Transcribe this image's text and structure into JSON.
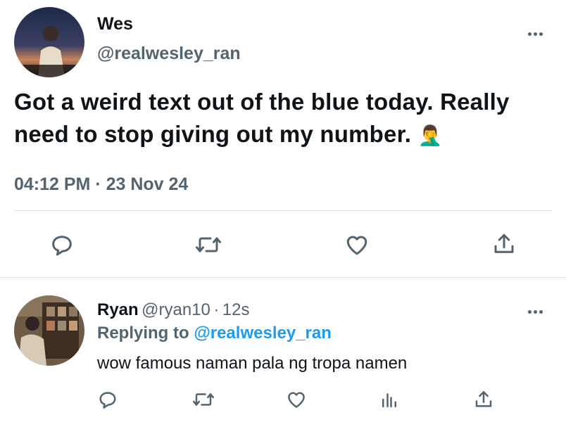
{
  "tweet": {
    "author_name": "Wes",
    "author_handle": "@realwesley_ran",
    "text": "Got a weird text out of the blue today. Really need to stop giving out my number.",
    "emoji": "🤦‍♂️",
    "timestamp": "04:12 PM · 23 Nov 24"
  },
  "reply": {
    "author_name": "Ryan",
    "author_handle": "@ryan10",
    "time_sep": "·",
    "time": "12s",
    "replying_prefix": "Replying to",
    "replying_to": "@realwesley_ran",
    "text": "wow famous naman pala ng tropa namen"
  },
  "icons": {
    "more": "more-horizontal-icon",
    "reply": "reply-bubble-icon",
    "retweet": "retweet-icon",
    "like": "heart-icon",
    "share": "share-icon",
    "views": "analytics-icon"
  },
  "colors": {
    "text": "#0f1419",
    "muted": "#536471",
    "accent": "#1d9bf0",
    "divider": "#dfe3e8"
  }
}
